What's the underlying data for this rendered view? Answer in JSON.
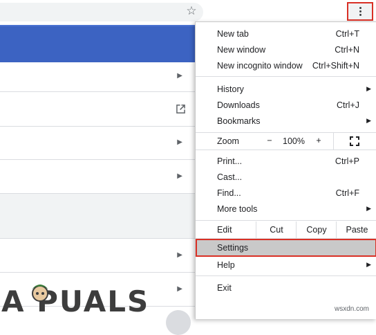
{
  "toolbar": {
    "bookmark_icon": "star-icon",
    "menu_icon": "kebab-icon",
    "accent": "#d93025"
  },
  "page": {
    "band_color": "#3c63c2",
    "rows": [
      "chevron-right-icon",
      "open-in-new-icon",
      "chevron-right-icon",
      "chevron-right-icon",
      "chevron-right-icon",
      "chevron-right-icon"
    ]
  },
  "menu": {
    "new_tab": {
      "label": "New tab",
      "shortcut": "Ctrl+T"
    },
    "new_window": {
      "label": "New window",
      "shortcut": "Ctrl+N"
    },
    "new_incognito": {
      "label": "New incognito window",
      "shortcut": "Ctrl+Shift+N"
    },
    "history": {
      "label": "History"
    },
    "downloads": {
      "label": "Downloads",
      "shortcut": "Ctrl+J"
    },
    "bookmarks": {
      "label": "Bookmarks"
    },
    "zoom": {
      "label": "Zoom",
      "minus": "−",
      "value": "100%",
      "plus": "+"
    },
    "print": {
      "label": "Print...",
      "shortcut": "Ctrl+P"
    },
    "cast": {
      "label": "Cast..."
    },
    "find": {
      "label": "Find...",
      "shortcut": "Ctrl+F"
    },
    "more_tools": {
      "label": "More tools"
    },
    "edit": {
      "label": "Edit",
      "cut": "Cut",
      "copy": "Copy",
      "paste": "Paste"
    },
    "settings": {
      "label": "Settings",
      "highlight": "#c9c9c9"
    },
    "help": {
      "label": "Help"
    },
    "exit": {
      "label": "Exit"
    }
  },
  "watermarks": {
    "logo_text": "A PUALS",
    "site": "wsxdn.com"
  }
}
